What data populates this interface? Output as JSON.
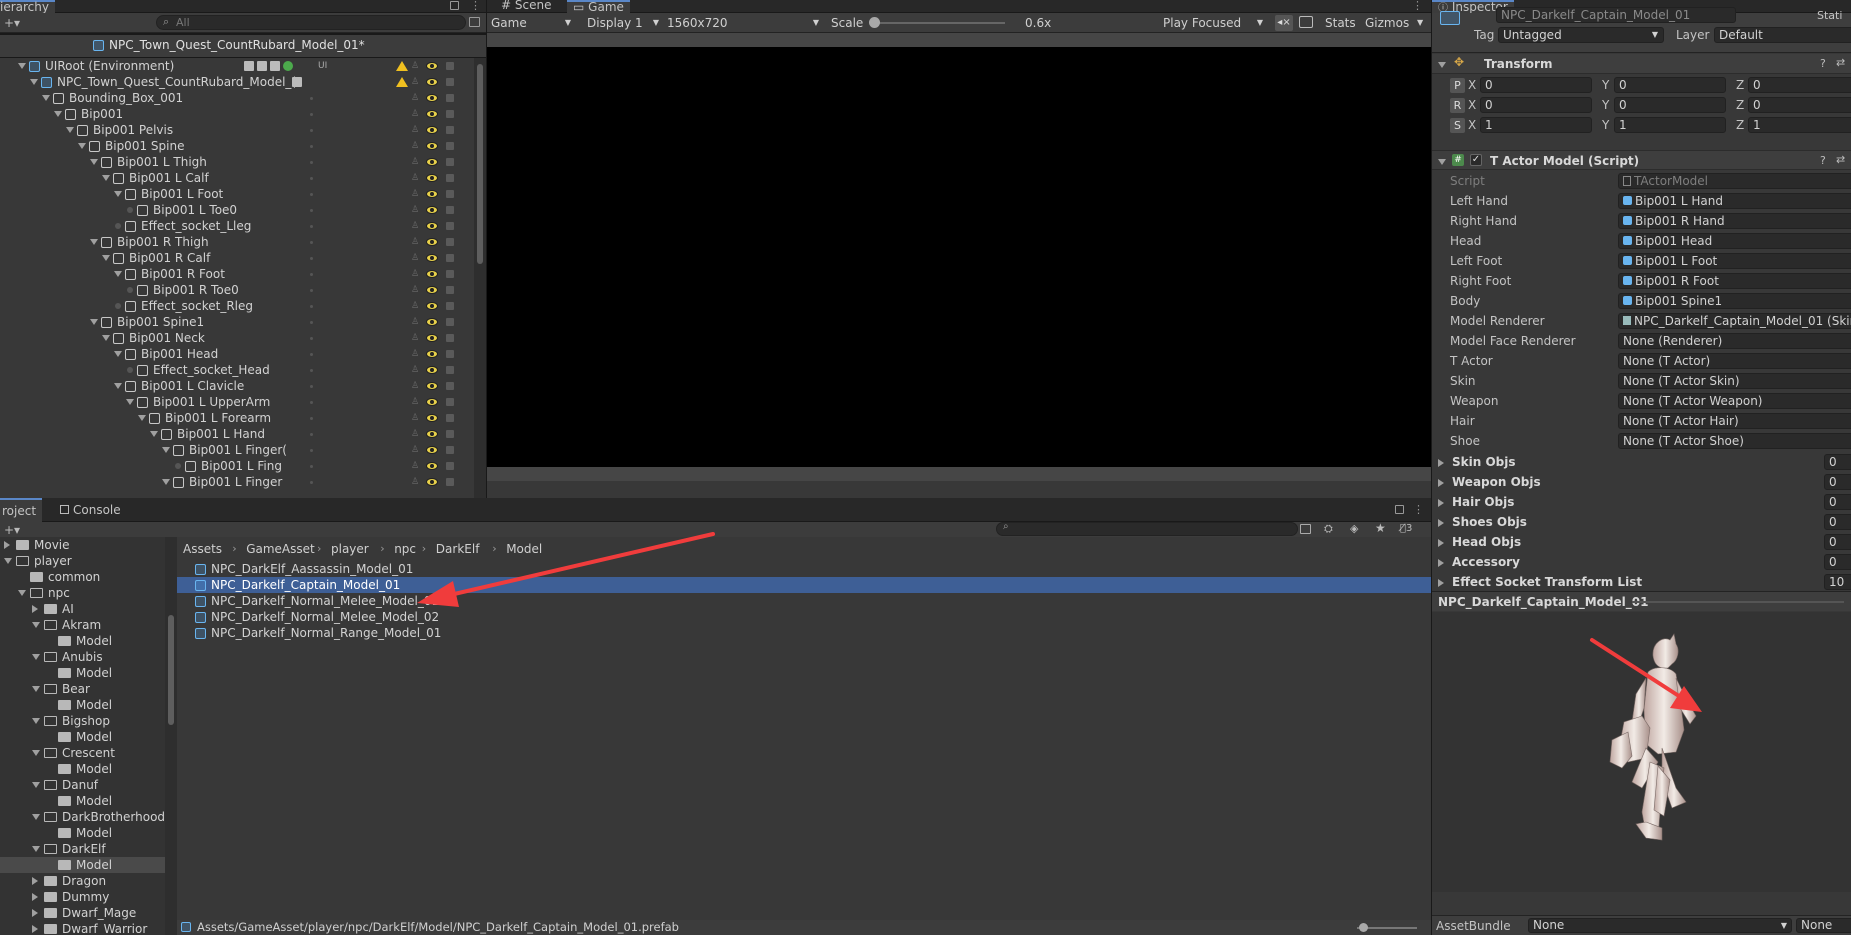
{
  "hierarchy": {
    "tab": "ierarchy",
    "search_placeholder": "All",
    "scene_title": "NPC_Town_Quest_CountRubard_Model_01*",
    "items": [
      {
        "label": "UIRoot (Environment)",
        "indent": 0,
        "arrow": "down",
        "tag": "UI"
      },
      {
        "label": "NPC_Town_Quest_CountRubard_Model_(",
        "indent": 1,
        "arrow": "down",
        "tag": ""
      },
      {
        "label": "Bounding_Box_001",
        "indent": 2,
        "arrow": "down",
        "tag": ""
      },
      {
        "label": "Bip001",
        "indent": 3,
        "arrow": "down",
        "tag": ""
      },
      {
        "label": "Bip001 Pelvis",
        "indent": 4,
        "arrow": "down",
        "tag": ""
      },
      {
        "label": "Bip001 Spine",
        "indent": 5,
        "arrow": "down",
        "tag": ""
      },
      {
        "label": "Bip001 L Thigh",
        "indent": 6,
        "arrow": "down",
        "tag": ""
      },
      {
        "label": "Bip001 L Calf",
        "indent": 7,
        "arrow": "down",
        "tag": ""
      },
      {
        "label": "Bip001 L Foot",
        "indent": 8,
        "arrow": "down",
        "tag": ""
      },
      {
        "label": "Bip001 L Toe0",
        "indent": 9,
        "arrow": "none",
        "tag": ""
      },
      {
        "label": "Effect_socket_Lleg",
        "indent": 8,
        "arrow": "none",
        "tag": ""
      },
      {
        "label": "Bip001 R Thigh",
        "indent": 6,
        "arrow": "down",
        "tag": ""
      },
      {
        "label": "Bip001 R Calf",
        "indent": 7,
        "arrow": "down",
        "tag": ""
      },
      {
        "label": "Bip001 R Foot",
        "indent": 8,
        "arrow": "down",
        "tag": ""
      },
      {
        "label": "Bip001 R Toe0",
        "indent": 9,
        "arrow": "none",
        "tag": ""
      },
      {
        "label": "Effect_socket_Rleg",
        "indent": 8,
        "arrow": "none",
        "tag": ""
      },
      {
        "label": "Bip001 Spine1",
        "indent": 6,
        "arrow": "down",
        "tag": ""
      },
      {
        "label": "Bip001 Neck",
        "indent": 7,
        "arrow": "down",
        "tag": ""
      },
      {
        "label": "Bip001 Head",
        "indent": 8,
        "arrow": "down",
        "tag": ""
      },
      {
        "label": "Effect_socket_Head",
        "indent": 9,
        "arrow": "none",
        "tag": ""
      },
      {
        "label": "Bip001 L Clavicle",
        "indent": 8,
        "arrow": "down",
        "tag": ""
      },
      {
        "label": "Bip001 L UpperArm",
        "indent": 9,
        "arrow": "down",
        "tag": ""
      },
      {
        "label": "Bip001 L Forearm",
        "indent": 10,
        "arrow": "down",
        "tag": ""
      },
      {
        "label": "Bip001 L Hand",
        "indent": 11,
        "arrow": "down",
        "tag": ""
      },
      {
        "label": "Bip001 L Finger(",
        "indent": 12,
        "arrow": "down",
        "tag": ""
      },
      {
        "label": "Bip001 L Fing",
        "indent": 13,
        "arrow": "none",
        "tag": ""
      },
      {
        "label": "Bip001 L Finger",
        "indent": 12,
        "arrow": "down",
        "tag": ""
      }
    ]
  },
  "game": {
    "tab_scene": "Scene",
    "tab_game": "Game",
    "view": "Game",
    "display": "Display 1",
    "resolution": "1560x720",
    "scale_label": "Scale",
    "scale_value": "0.6x",
    "play_mode": "Play Focused",
    "stats": "Stats",
    "gizmos": "Gizmos"
  },
  "project": {
    "tab_project": "roject",
    "tab_console": "Console",
    "hidden_count": "3",
    "breadcrumb": [
      "Assets",
      "GameAsset",
      "player",
      "npc",
      "DarkElf",
      "Model"
    ],
    "tree": [
      {
        "label": "Movie",
        "indent": 0,
        "arrow": "right",
        "open": false
      },
      {
        "label": "player",
        "indent": 0,
        "arrow": "down",
        "open": true
      },
      {
        "label": "common",
        "indent": 1,
        "arrow": "none",
        "open": false
      },
      {
        "label": "npc",
        "indent": 1,
        "arrow": "down",
        "open": true
      },
      {
        "label": "AI",
        "indent": 2,
        "arrow": "right",
        "open": false
      },
      {
        "label": "Akram",
        "indent": 2,
        "arrow": "down",
        "open": true
      },
      {
        "label": "Model",
        "indent": 3,
        "arrow": "none",
        "open": false
      },
      {
        "label": "Anubis",
        "indent": 2,
        "arrow": "down",
        "open": true
      },
      {
        "label": "Model",
        "indent": 3,
        "arrow": "none",
        "open": false
      },
      {
        "label": "Bear",
        "indent": 2,
        "arrow": "down",
        "open": true
      },
      {
        "label": "Model",
        "indent": 3,
        "arrow": "none",
        "open": false
      },
      {
        "label": "Bigshop",
        "indent": 2,
        "arrow": "down",
        "open": true
      },
      {
        "label": "Model",
        "indent": 3,
        "arrow": "none",
        "open": false
      },
      {
        "label": "Crescent",
        "indent": 2,
        "arrow": "down",
        "open": true
      },
      {
        "label": "Model",
        "indent": 3,
        "arrow": "none",
        "open": false
      },
      {
        "label": "Danuf",
        "indent": 2,
        "arrow": "down",
        "open": true
      },
      {
        "label": "Model",
        "indent": 3,
        "arrow": "none",
        "open": false
      },
      {
        "label": "DarkBrotherhood",
        "indent": 2,
        "arrow": "down",
        "open": true
      },
      {
        "label": "Model",
        "indent": 3,
        "arrow": "none",
        "open": false
      },
      {
        "label": "DarkElf",
        "indent": 2,
        "arrow": "down",
        "open": true
      },
      {
        "label": "Model",
        "indent": 3,
        "arrow": "none",
        "open": false,
        "selected": true
      },
      {
        "label": "Dragon",
        "indent": 2,
        "arrow": "right",
        "open": false
      },
      {
        "label": "Dummy",
        "indent": 2,
        "arrow": "right",
        "open": false
      },
      {
        "label": "Dwarf_Mage",
        "indent": 2,
        "arrow": "right",
        "open": false
      },
      {
        "label": "Dwarf_Warrior",
        "indent": 2,
        "arrow": "right",
        "open": false
      }
    ],
    "files": [
      {
        "label": "NPC_DarkElf_Aassassin_Model_01",
        "selected": false
      },
      {
        "label": "NPC_Darkelf_Captain_Model_01",
        "selected": true
      },
      {
        "label": "NPC_Darkelf_Normal_Melee_Model_01",
        "selected": false
      },
      {
        "label": "NPC_Darkelf_Normal_Melee_Model_02",
        "selected": false
      },
      {
        "label": "NPC_Darkelf_Normal_Range_Model_01",
        "selected": false
      }
    ],
    "status_path": "Assets/GameAsset/player/npc/DarkElf/Model/NPC_Darkelf_Captain_Model_01.prefab"
  },
  "inspector": {
    "tab": "Inspector",
    "object_name": "NPC_Darkelf_Captain_Model_01",
    "static_label": "Stati",
    "tag_label": "Tag",
    "tag_value": "Untagged",
    "layer_label": "Layer",
    "layer_value": "Default",
    "transform": {
      "title": "Transform",
      "rows": [
        {
          "key": "P",
          "x": "0",
          "y": "0",
          "z": "0"
        },
        {
          "key": "R",
          "x": "0",
          "y": "0",
          "z": "0"
        },
        {
          "key": "S",
          "x": "1",
          "y": "1",
          "z": "1"
        }
      ]
    },
    "script_component": {
      "title": "T Actor Model (Script)",
      "fields": [
        {
          "label": "Script",
          "value": "TActorModel",
          "icon": "script",
          "dim": true
        },
        {
          "label": "Left Hand",
          "value": "Bip001 L Hand",
          "icon": "obj"
        },
        {
          "label": "Right Hand",
          "value": "Bip001 R Hand",
          "icon": "obj"
        },
        {
          "label": "Head",
          "value": "Bip001 Head",
          "icon": "obj"
        },
        {
          "label": "Left Foot",
          "value": "Bip001 L Foot",
          "icon": "obj"
        },
        {
          "label": "Right Foot",
          "value": "Bip001 R Foot",
          "icon": "obj"
        },
        {
          "label": "Body",
          "value": "Bip001 Spine1",
          "icon": "obj"
        },
        {
          "label": "Model Renderer",
          "value": "NPC_Darkelf_Captain_Model_01 (Skinn",
          "icon": "renderer"
        },
        {
          "label": "Model Face Renderer",
          "value": "None (Renderer)",
          "icon": ""
        },
        {
          "label": "T Actor",
          "value": "None (T Actor)",
          "icon": ""
        },
        {
          "label": "Skin",
          "value": "None (T Actor Skin)",
          "icon": ""
        },
        {
          "label": "Weapon",
          "value": "None (T Actor Weapon)",
          "icon": ""
        },
        {
          "label": "Hair",
          "value": "None (T Actor Hair)",
          "icon": ""
        },
        {
          "label": "Shoe",
          "value": "None (T Actor Shoe)",
          "icon": ""
        }
      ],
      "lists": [
        {
          "label": "Skin Objs",
          "count": "0"
        },
        {
          "label": "Weapon Objs",
          "count": "0"
        },
        {
          "label": "Hair Objs",
          "count": "0"
        },
        {
          "label": "Shoes Objs",
          "count": "0"
        },
        {
          "label": "Head Objs",
          "count": "0"
        },
        {
          "label": "Accessory",
          "count": "0"
        },
        {
          "label": "Effect Socket Transform List",
          "count": "10"
        }
      ]
    },
    "preview_title": "NPC_Darkelf_Captain_Model_01",
    "assetbundle_label": "AssetBundle",
    "assetbundle_value": "None",
    "assetbundle_variant": "None"
  },
  "colors": {
    "accent": "#5a87c8",
    "selection": "#3e5f96",
    "annotation_arrow": "#f03c3c",
    "visibility_eye": "#e8d14a"
  }
}
